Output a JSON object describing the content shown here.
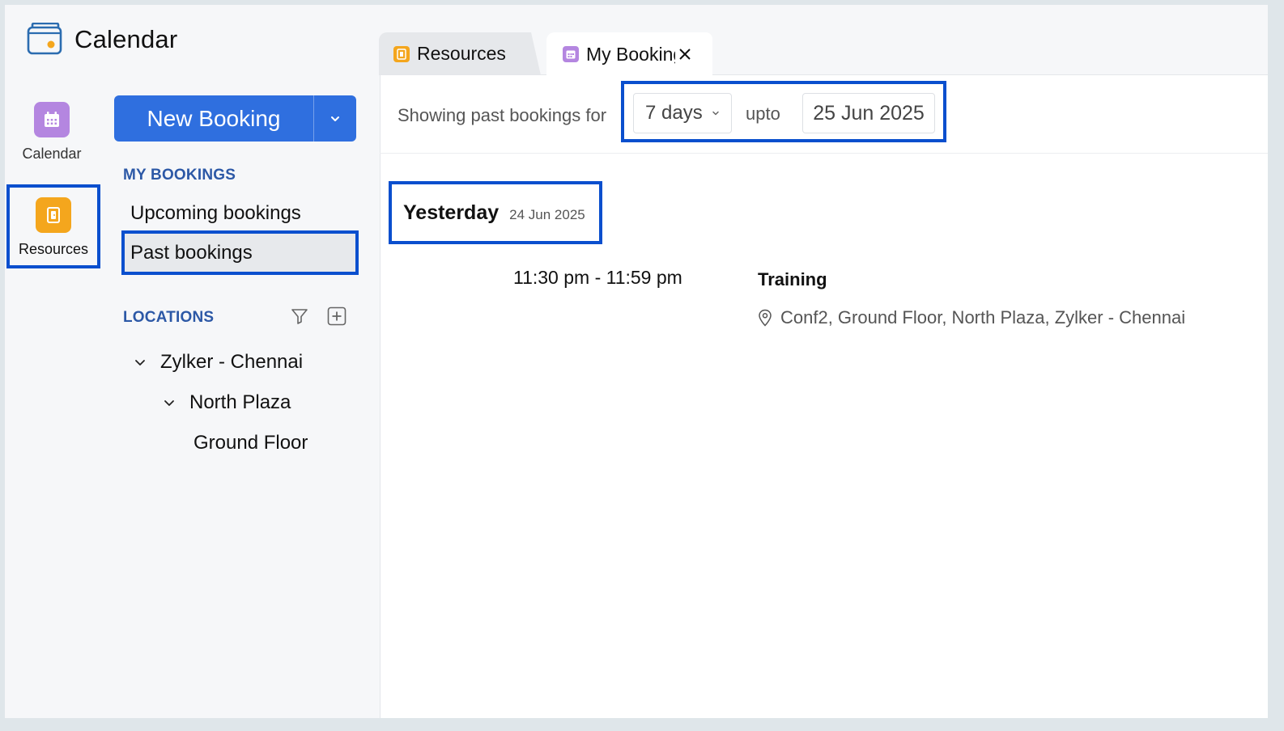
{
  "app": {
    "title": "Calendar"
  },
  "rail": {
    "items": [
      {
        "label": "Calendar",
        "icon": "calendar-icon",
        "color": "#b486e0"
      },
      {
        "label": "Resources",
        "icon": "resource-icon",
        "color": "#f4a61d"
      }
    ]
  },
  "sidebar": {
    "new_booking_label": "New Booking",
    "my_bookings_heading": "MY BOOKINGS",
    "nav": [
      {
        "label": "Upcoming bookings"
      },
      {
        "label": "Past bookings",
        "selected": true
      }
    ],
    "locations_heading": "LOCATIONS",
    "tree": [
      {
        "label": "Zylker - Chennai",
        "expanded": true
      },
      {
        "label": "North Plaza",
        "expanded": true
      },
      {
        "label": "Ground Floor"
      }
    ]
  },
  "tabs": [
    {
      "label": "Resources",
      "icon": "resource-icon"
    },
    {
      "label": "My Bookings",
      "icon": "calendar-icon",
      "active": true
    }
  ],
  "filter": {
    "prefix": "Showing past bookings for",
    "range": "7 days",
    "upto": "upto",
    "date": "25 Jun 2025"
  },
  "day_group": {
    "title": "Yesterday",
    "date": "24 Jun 2025"
  },
  "booking": {
    "time": "11:30 pm - 11:59 pm",
    "title": "Training",
    "location": "Conf2, Ground Floor, North Plaza, Zylker - Chennai"
  },
  "colors": {
    "accent": "#2f6fdf",
    "highlight": "#0a4fce",
    "heading": "#2c58a6"
  }
}
